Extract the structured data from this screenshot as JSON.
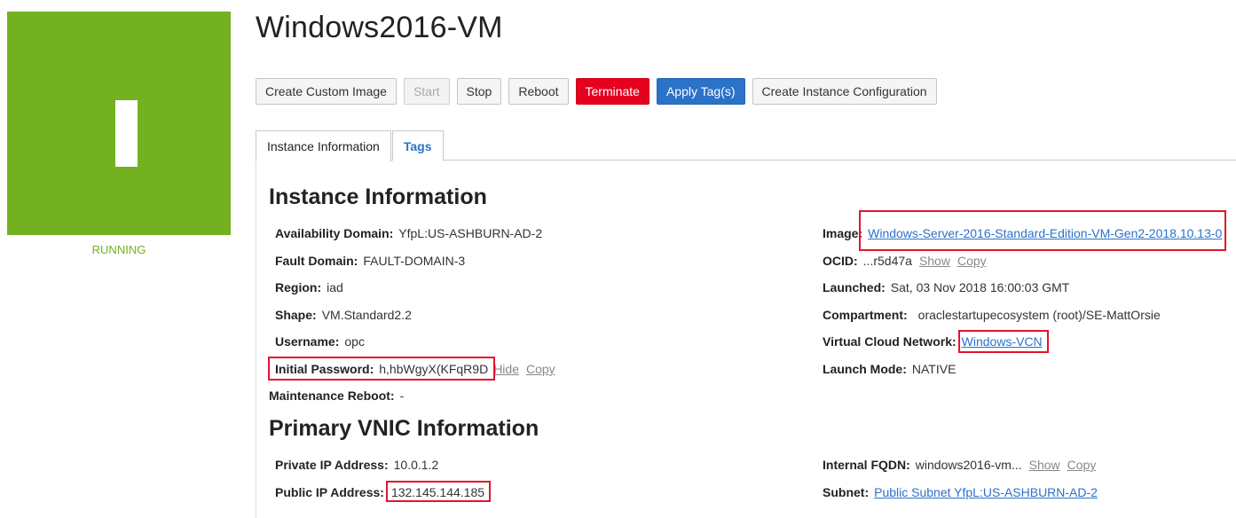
{
  "instance": {
    "status": "RUNNING",
    "title": "Windows2016-VM",
    "status_color": "#73b121"
  },
  "toolbar": {
    "create_custom_image": "Create Custom Image",
    "start": "Start",
    "stop": "Stop",
    "reboot": "Reboot",
    "terminate": "Terminate",
    "apply_tags": "Apply Tag(s)",
    "create_instance_config": "Create Instance Configuration"
  },
  "tabs": {
    "instance_information": "Instance Information",
    "tags": "Tags"
  },
  "instance_info": {
    "section_title": "Instance Information",
    "availability_domain": {
      "label": "Availability Domain:",
      "value": "YfpL:US-ASHBURN-AD-2"
    },
    "fault_domain": {
      "label": "Fault Domain:",
      "value": "FAULT-DOMAIN-3"
    },
    "region": {
      "label": "Region:",
      "value": "iad"
    },
    "shape": {
      "label": "Shape:",
      "value": "VM.Standard2.2"
    },
    "username": {
      "label": "Username:",
      "value": "opc"
    },
    "initial_password": {
      "label": "Initial Password:",
      "value": "h,hbWgyX(KFqR9D",
      "hide": "Hide",
      "copy": "Copy"
    },
    "maintenance_reboot": {
      "label": "Maintenance Reboot:",
      "value": "-"
    },
    "image": {
      "label": "Image:",
      "value": "Windows-Server-2016-Standard-Edition-VM-Gen2-2018.10.13-0"
    },
    "ocid": {
      "label": "OCID:",
      "value": "...r5d47a",
      "show": "Show",
      "copy": "Copy"
    },
    "launched": {
      "label": "Launched:",
      "value": "Sat, 03 Nov 2018 16:00:03 GMT"
    },
    "compartment": {
      "label": "Compartment:",
      "value": "oraclestartupecosystem (root)/SE-MattOrsie"
    },
    "vcn": {
      "label": "Virtual Cloud Network:",
      "value": "Windows-VCN"
    },
    "launch_mode": {
      "label": "Launch Mode:",
      "value": "NATIVE"
    }
  },
  "vnic_info": {
    "section_title": "Primary VNIC Information",
    "private_ip": {
      "label": "Private IP Address:",
      "value": "10.0.1.2"
    },
    "public_ip": {
      "label": "Public IP Address:",
      "value": "132.145.144.185"
    },
    "internal_fqdn": {
      "label": "Internal FQDN:",
      "value": "windows2016-vm...",
      "show": "Show",
      "copy": "Copy"
    },
    "subnet": {
      "label": "Subnet:",
      "value": "Public Subnet YfpL:US-ASHBURN-AD-2"
    }
  },
  "colors": {
    "accent": "#2b72c9",
    "danger": "#e5001e",
    "highlight": "#e3142c",
    "running": "#73b121"
  }
}
